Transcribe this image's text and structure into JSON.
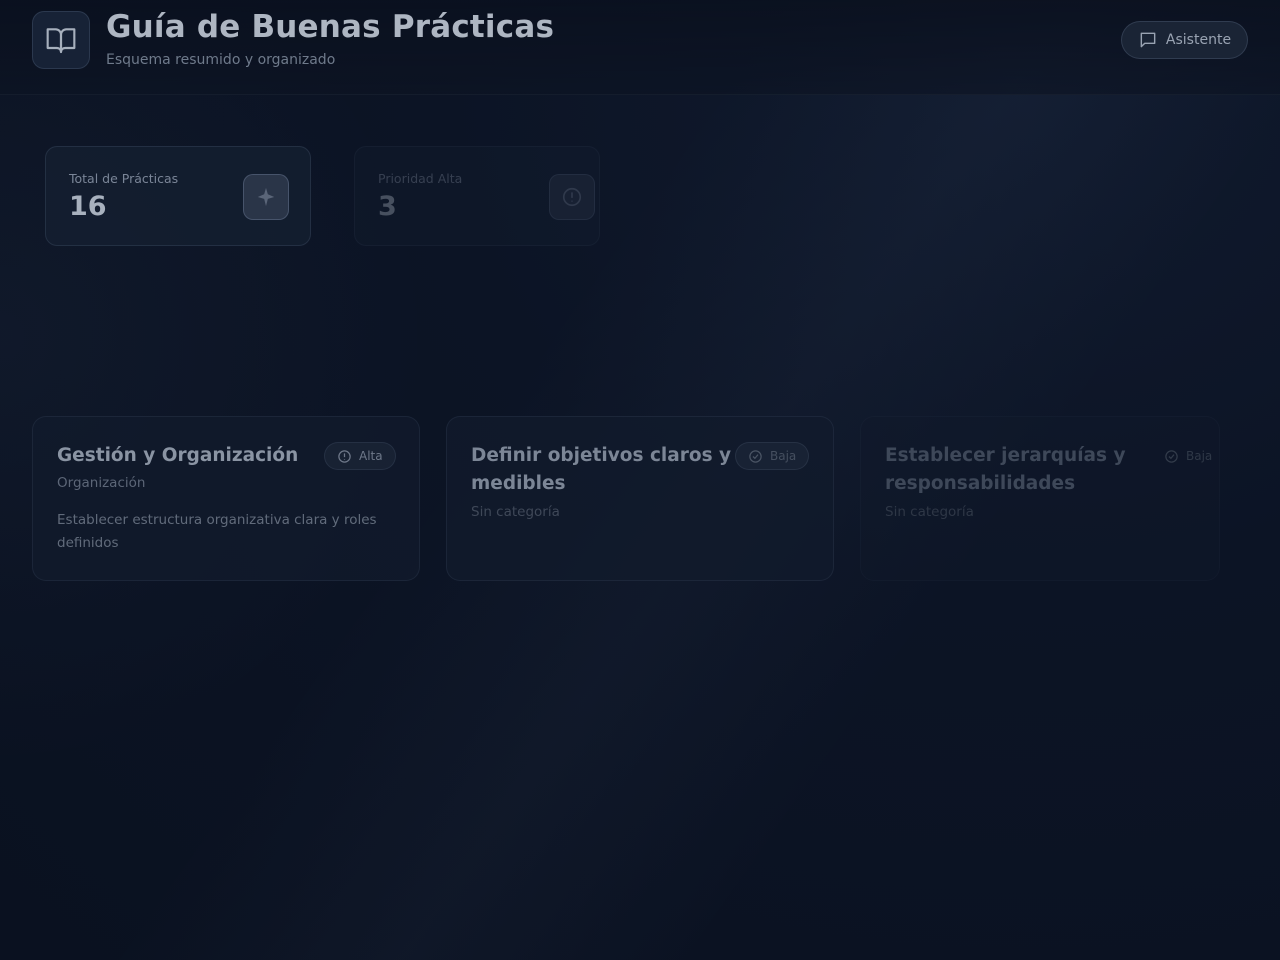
{
  "header": {
    "title": "Guía de Buenas Prácticas",
    "subtitle": "Esquema resumido y organizado",
    "logo_icon": "book-open-icon",
    "assistant_label": "Asistente",
    "assistant_icon": "chat-icon"
  },
  "stats": [
    {
      "label": "Total de Prácticas",
      "value": "16",
      "icon": "sparkle-icon"
    },
    {
      "label": "Prioridad Alta",
      "value": "3",
      "icon": "alert-circle-icon"
    }
  ],
  "cards": [
    {
      "title": "Gestión y Organización",
      "category": "Organización",
      "description": "Establecer estructura organizativa clara y roles definidos",
      "priority": "Alta",
      "priority_icon": "alert-circle-icon"
    },
    {
      "title": "Definir objetivos claros y medibles",
      "category": "Sin categoría",
      "description": "",
      "priority": "Baja",
      "priority_icon": "check-circle-icon"
    },
    {
      "title": "Establecer jerarquías y responsabilidades",
      "category": "Sin categoría",
      "description": "",
      "priority": "Baja",
      "priority_icon": "check-circle-icon"
    }
  ],
  "colors": {
    "background": "#0c1425",
    "card": "#141e30",
    "text_primary": "#aeb6c2",
    "text_muted": "#6f7a8b"
  }
}
